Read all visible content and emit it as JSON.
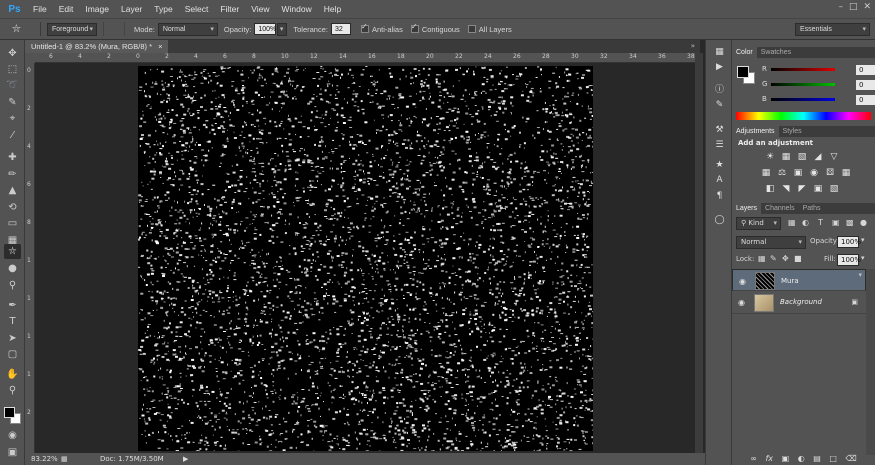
{
  "menu": {
    "logo": "Ps",
    "items": [
      "File",
      "Edit",
      "Image",
      "Layer",
      "Type",
      "Select",
      "Filter",
      "View",
      "Window",
      "Help"
    ]
  },
  "window_controls": {
    "minimize": "–",
    "maximize": "□",
    "close": "✕"
  },
  "options": {
    "fill_source": "Foreground",
    "mode_label": "Mode:",
    "mode_value": "Normal",
    "opacity_label": "Opacity:",
    "opacity_value": "100%",
    "tolerance_label": "Tolerance:",
    "tolerance_value": "32",
    "anti_alias_label": "Anti-alias",
    "contiguous_label": "Contiguous",
    "all_layers_label": "All Layers",
    "workspace": "Essentials"
  },
  "document": {
    "tab_title": "Untitled-1 @ 83.2% (Mura, RGB/8) *",
    "tab_close": "×"
  },
  "ruler_h_ticks": [
    "6",
    "4",
    "2",
    "0",
    "2",
    "4",
    "6",
    "8",
    "10",
    "12",
    "14",
    "16",
    "18",
    "20",
    "22",
    "24",
    "26",
    "28",
    "30",
    "32",
    "34",
    "36",
    "38"
  ],
  "ruler_v_ticks": [
    "0",
    "2",
    "4",
    "6",
    "8",
    "1",
    "1",
    "1",
    "1",
    "2"
  ],
  "status": {
    "zoom": "83.22%",
    "doc": "Doc: 1.75M/3.50M"
  },
  "color_panel": {
    "tabs": [
      "Color",
      "Swatches"
    ],
    "channels": [
      {
        "label": "R",
        "value": "0",
        "gradient": "#e00000"
      },
      {
        "label": "G",
        "value": "0",
        "gradient": "#00c000"
      },
      {
        "label": "B",
        "value": "0",
        "gradient": "#0000e0"
      }
    ]
  },
  "adjustments_panel": {
    "tabs": [
      "Adjustments",
      "Styles"
    ],
    "title": "Add an adjustment"
  },
  "layers_panel": {
    "tabs": [
      "Layers",
      "Channels",
      "Paths"
    ],
    "kind": "Kind",
    "blend_mode": "Normal",
    "opacity_label": "Opacity:",
    "opacity_value": "100%",
    "lock_label": "Lock:",
    "fill_label": "Fill:",
    "fill_value": "100%",
    "layers": [
      {
        "name": "Mura",
        "selected": true
      },
      {
        "name": "Background",
        "selected": false
      }
    ]
  },
  "colors": {
    "accent": "#31a8ff",
    "panel": "#535353",
    "canvas_bg": "#282828",
    "selected_layer": "#5e6b7a"
  }
}
